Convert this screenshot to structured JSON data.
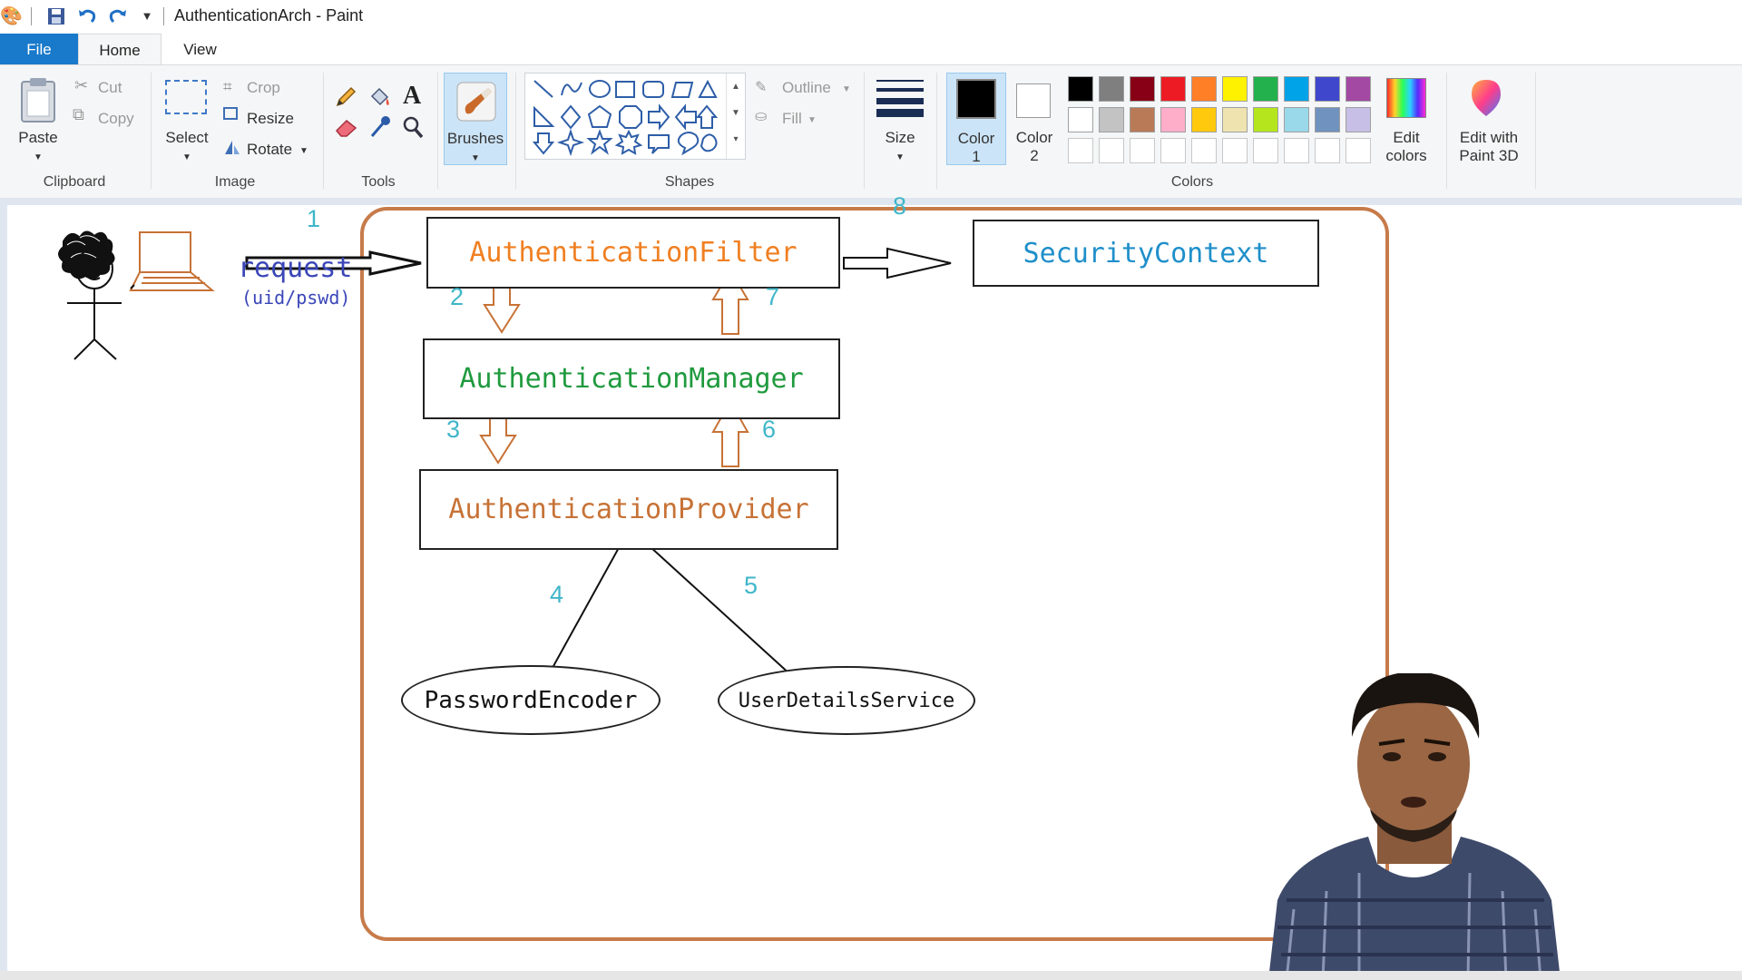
{
  "window": {
    "title": "AuthenticationArch - Paint"
  },
  "quick_access": {
    "icons": [
      "paint-app-icon",
      "save-icon",
      "undo-icon",
      "redo-icon",
      "customize-arrow-icon"
    ]
  },
  "tabs": {
    "file": "File",
    "home": "Home",
    "view": "View"
  },
  "ribbon": {
    "clipboard": {
      "group": "Clipboard",
      "paste": "Paste",
      "cut": "Cut",
      "copy": "Copy"
    },
    "image": {
      "group": "Image",
      "select": "Select",
      "crop": "Crop",
      "resize": "Resize",
      "rotate": "Rotate"
    },
    "tools": {
      "group": "Tools"
    },
    "brushes": "Brushes",
    "shapes": {
      "group": "Shapes",
      "outline": "Outline",
      "fill": "Fill"
    },
    "size": "Size",
    "color1": {
      "label": "Color",
      "num": "1",
      "value": "#000000"
    },
    "color2": {
      "label": "Color",
      "num": "2",
      "value": "#ffffff"
    },
    "colors": {
      "group": "Colors",
      "edit_line1": "Edit",
      "edit_line2": "colors",
      "palette_row1": [
        "#000000",
        "#7f7f7f",
        "#880015",
        "#ed1c24",
        "#ff7f27",
        "#fff200",
        "#22b14c",
        "#00a2e8",
        "#3f48cc",
        "#a349a4"
      ],
      "palette_row2": [
        "#ffffff",
        "#c3c3c3",
        "#b97a57",
        "#ffaec9",
        "#ffc90e",
        "#efe4b0",
        "#b5e61d",
        "#99d9ea",
        "#7092be",
        "#c8bfe7"
      ]
    },
    "paint3d": {
      "line1": "Edit with",
      "line2": "Paint 3D"
    }
  },
  "diagram": {
    "request": "request",
    "request_sub": "(uid/pswd)",
    "boxes": {
      "filter": "AuthenticationFilter",
      "context": "SecurityContext",
      "manager": "AuthenticationManager",
      "provider": "AuthenticationProvider"
    },
    "ellipses": {
      "encoder": "PasswordEncoder",
      "uds": "UserDetailsService"
    },
    "steps": [
      "1",
      "2",
      "3",
      "4",
      "5",
      "6",
      "7",
      "8"
    ],
    "colors": {
      "filter": "#f07f21",
      "context": "#1f8fca",
      "manager": "#1f9a3e",
      "provider": "#c77236",
      "steps": "#3fb6c9",
      "request": "#3a46b8",
      "frame": "#c77b4a"
    }
  }
}
